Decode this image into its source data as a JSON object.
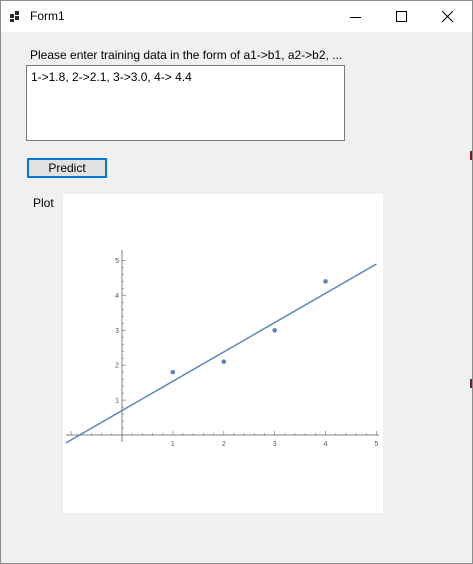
{
  "window": {
    "title": "Form1",
    "app_icon": "winforms-app-icon"
  },
  "controls": {
    "minimize": "minimize-icon",
    "maximize": "maximize-icon",
    "close": "close-icon"
  },
  "prompt": {
    "label": "Please enter training data in the form of a1->b1, a2->b2, ..."
  },
  "input": {
    "value": "1->1.8, 2->2.1, 3->3.0, 4-> 4.4"
  },
  "predict_button": {
    "label": "Predict"
  },
  "plot": {
    "label": "Plot"
  },
  "colors": {
    "series": "#5b84b8",
    "focus_border": "#0078d7",
    "axis": "#808080"
  },
  "chart_data": {
    "type": "scatter",
    "points": {
      "x": [
        1,
        2,
        3,
        4
      ],
      "y": [
        1.8,
        2.1,
        3.0,
        4.4
      ]
    },
    "fit_line": {
      "slope": 0.84,
      "intercept": 0.7,
      "x_range": [
        -1.1,
        5
      ]
    },
    "xlim": [
      -1.1,
      5.05
    ],
    "ylim": [
      -0.2,
      5.3
    ],
    "xticks": [
      "1",
      "2",
      "3",
      "4",
      "5"
    ],
    "yticks": [
      "1",
      "2",
      "3",
      "4",
      "5"
    ],
    "grid": false
  }
}
